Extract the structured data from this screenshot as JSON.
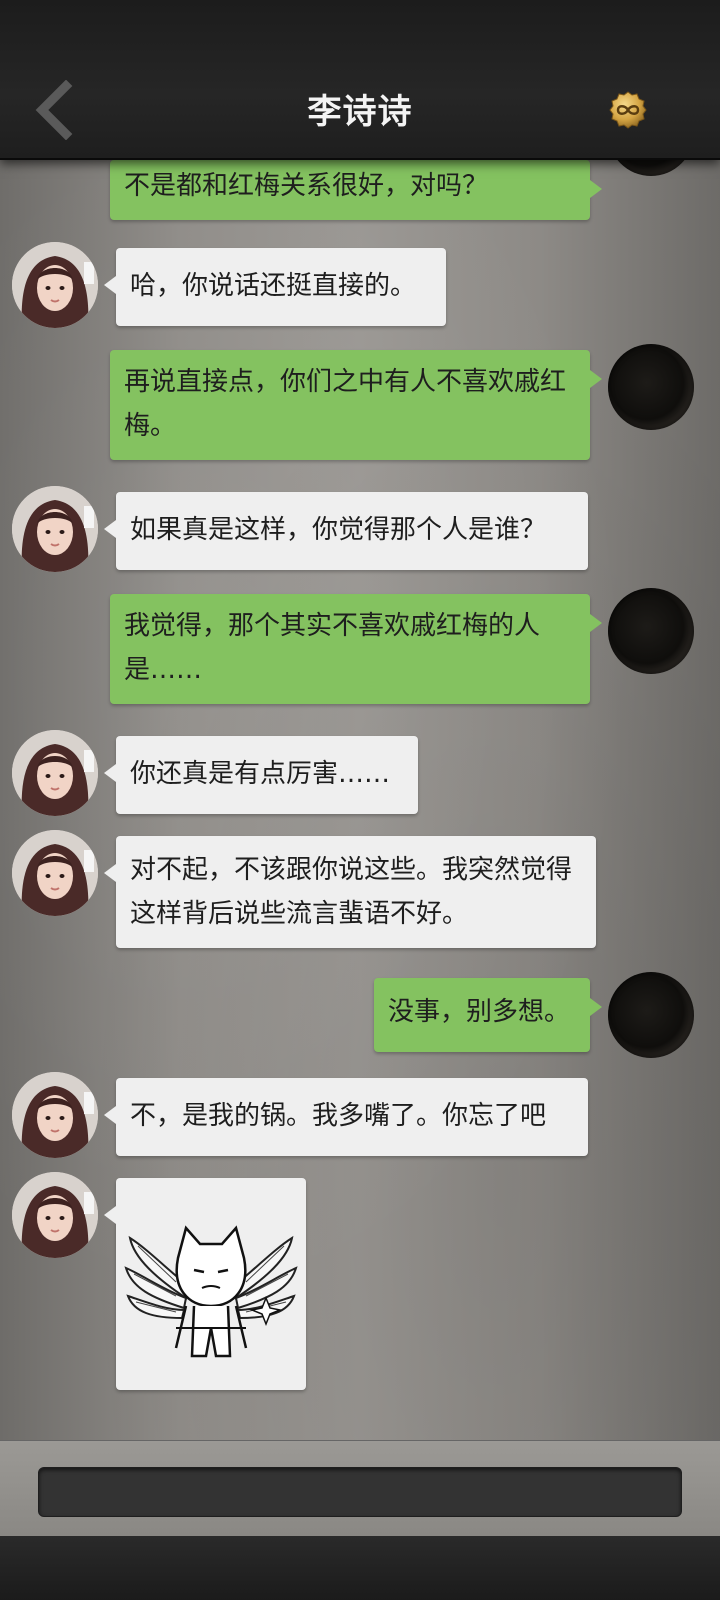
{
  "header": {
    "title": "李诗诗",
    "back_icon": "chevron-left-icon",
    "coin_icon": "gold-infinity-coin-icon"
  },
  "messages": [
    {
      "side": "right",
      "text": "不是都和红梅关系很好，对吗？"
    },
    {
      "side": "left",
      "text": "哈，你说话还挺直接的。"
    },
    {
      "side": "right",
      "text": "再说直接点，你们之中有人不喜欢戚红梅。"
    },
    {
      "side": "left",
      "text": "如果真是这样，你觉得那个人是谁？"
    },
    {
      "side": "right",
      "text": "我觉得，那个其实不喜欢戚红梅的人是……"
    },
    {
      "side": "left",
      "text": "你还真是有点厉害……"
    },
    {
      "side": "left",
      "text": "对不起，不该跟你说这些。我突然觉得这样背后说些流言蜚语不好。"
    },
    {
      "side": "right",
      "text": "没事，别多想。"
    },
    {
      "side": "left",
      "text": "不，是我的锅。我多嘴了。你忘了吧"
    },
    {
      "side": "left",
      "sticker": "cat-with-feather-wings-sticker"
    }
  ],
  "input": {
    "value": "",
    "placeholder": ""
  },
  "colors": {
    "bubble_right": "#84c260",
    "bubble_left": "#efefef",
    "header": "#262626"
  }
}
